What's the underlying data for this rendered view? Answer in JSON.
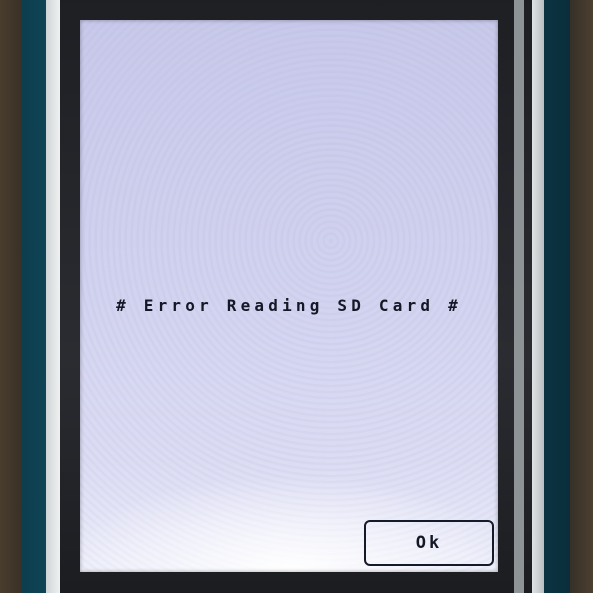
{
  "dialog": {
    "message": "# Error Reading SD Card #",
    "ok_label": "Ok"
  },
  "colors": {
    "screen_background": "#d2d3ef",
    "text": "#141826",
    "button_border": "#151a2a",
    "pcb": "#0f4a5c",
    "bezel": "#f1f3f3"
  }
}
